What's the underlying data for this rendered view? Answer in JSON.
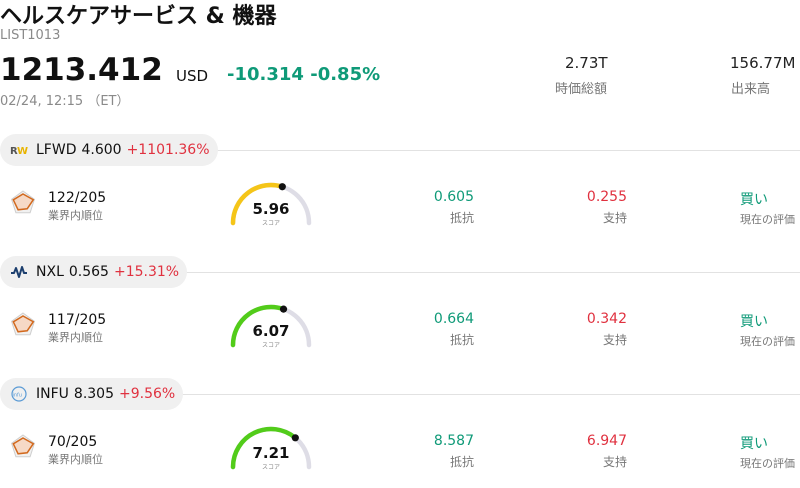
{
  "header": {
    "title": "ヘルスケアサービス & 機器",
    "code": "LIST1013",
    "price": "1213.412",
    "currency": "USD",
    "change": "-10.314",
    "change_pct": "-0.85%",
    "timestamp": "02/24, 12:15 （ET）",
    "market_cap": {
      "value": "2.73T",
      "label": "時価総額"
    },
    "volume": {
      "value": "156.77M",
      "label": "出来高"
    }
  },
  "colors": {
    "up": "#e0313f",
    "down": "#0f9a78",
    "score_yellow": "#f5c518",
    "score_green": "#52cc1a",
    "track": "#dedde6"
  },
  "stocks": [
    {
      "logo": "rw-logo-icon",
      "symbol": "LFWD",
      "price": "4.600",
      "change_pct": "+1101.36%",
      "rank": "122/205",
      "rank_label": "業界内順位",
      "score": "5.96",
      "score_value": 5.96,
      "score_label": "スコア",
      "resistance": "0.605",
      "resistance_label": "抵抗",
      "support": "0.255",
      "support_label": "支持",
      "rating": "買い",
      "rating_label": "現在の評価"
    },
    {
      "logo": "pulse-logo-icon",
      "symbol": "NXL",
      "price": "0.565",
      "change_pct": "+15.31%",
      "rank": "117/205",
      "rank_label": "業界内順位",
      "score": "6.07",
      "score_value": 6.07,
      "score_label": "スコア",
      "resistance": "0.664",
      "resistance_label": "抵抗",
      "support": "0.342",
      "support_label": "支持",
      "rating": "買い",
      "rating_label": "現在の評価"
    },
    {
      "logo": "infu-logo-icon",
      "symbol": "INFU",
      "price": "8.305",
      "change_pct": "+9.56%",
      "rank": "70/205",
      "rank_label": "業界内順位",
      "score": "7.21",
      "score_value": 7.21,
      "score_label": "スコア",
      "resistance": "8.587",
      "resistance_label": "抵抗",
      "support": "6.947",
      "support_label": "支持",
      "rating": "買い",
      "rating_label": "現在の評価"
    }
  ]
}
